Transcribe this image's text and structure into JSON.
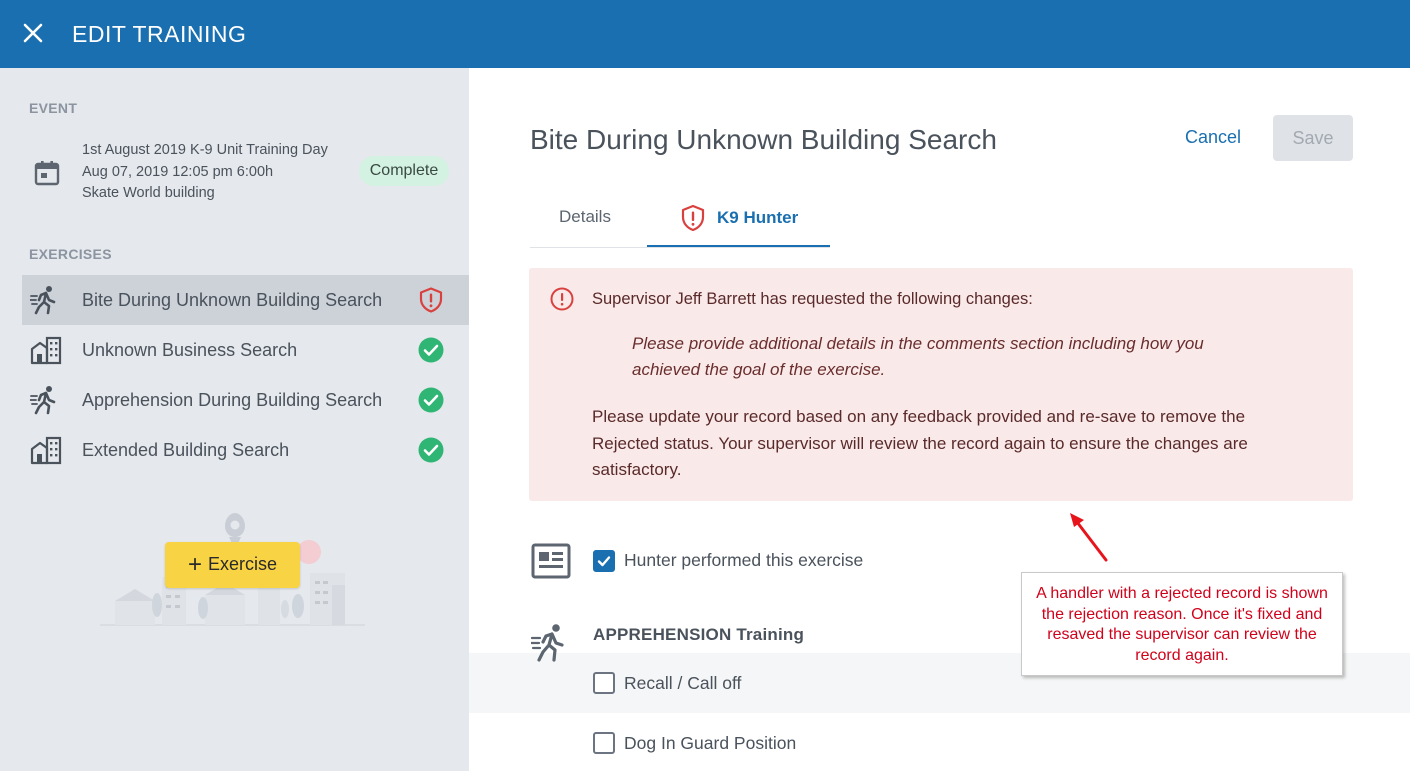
{
  "topbar": {
    "title": "EDIT TRAINING"
  },
  "sidebar": {
    "event_label": "EVENT",
    "event": {
      "name": "1st August 2019 K-9 Unit Training Day",
      "datetime": "Aug 07, 2019 12:05 pm 6:00h",
      "location": "Skate World building",
      "status": "Complete"
    },
    "exercises_label": "EXERCISES",
    "exercises": [
      {
        "label": "Bite During Unknown Building Search",
        "icon": "runner-icon",
        "status": "rejected"
      },
      {
        "label": "Unknown Business Search",
        "icon": "building-icon",
        "status": "complete"
      },
      {
        "label": "Apprehension During Building Search",
        "icon": "runner-icon",
        "status": "complete"
      },
      {
        "label": "Extended Building Search",
        "icon": "building-icon",
        "status": "complete"
      }
    ],
    "add_button": "Exercise"
  },
  "main": {
    "title": "Bite During Unknown Building Search",
    "cancel": "Cancel",
    "save": "Save",
    "tabs": [
      {
        "label": "Details"
      },
      {
        "label": "K9 Hunter"
      }
    ],
    "alert": {
      "title": "Supervisor Jeff Barrett has requested the following changes:",
      "quote": "Please provide additional details in the comments section including how you achieved the goal of the exercise.",
      "body": "Please update your record based on any feedback provided and re-save to remove the Rejected status. Your supervisor will review the record again to ensure the changes are satisfactory."
    },
    "performed": {
      "label": "Hunter performed this exercise",
      "checked": true
    },
    "section": "APPREHENSION Training",
    "items": [
      {
        "label": "Recall / Call off",
        "checked": false
      },
      {
        "label": "Dog In Guard Position",
        "checked": false
      }
    ]
  },
  "annotation": {
    "text": "A handler with a rejected record is shown the rejection reason. Once it's fixed and resaved the supervisor can review the record again."
  },
  "colors": {
    "primary": "#1a6fb0",
    "reject_red": "#d9413f",
    "complete_green": "#2fb574",
    "alert_bg": "#f9e9e9",
    "annotation_red": "#d0021b"
  }
}
